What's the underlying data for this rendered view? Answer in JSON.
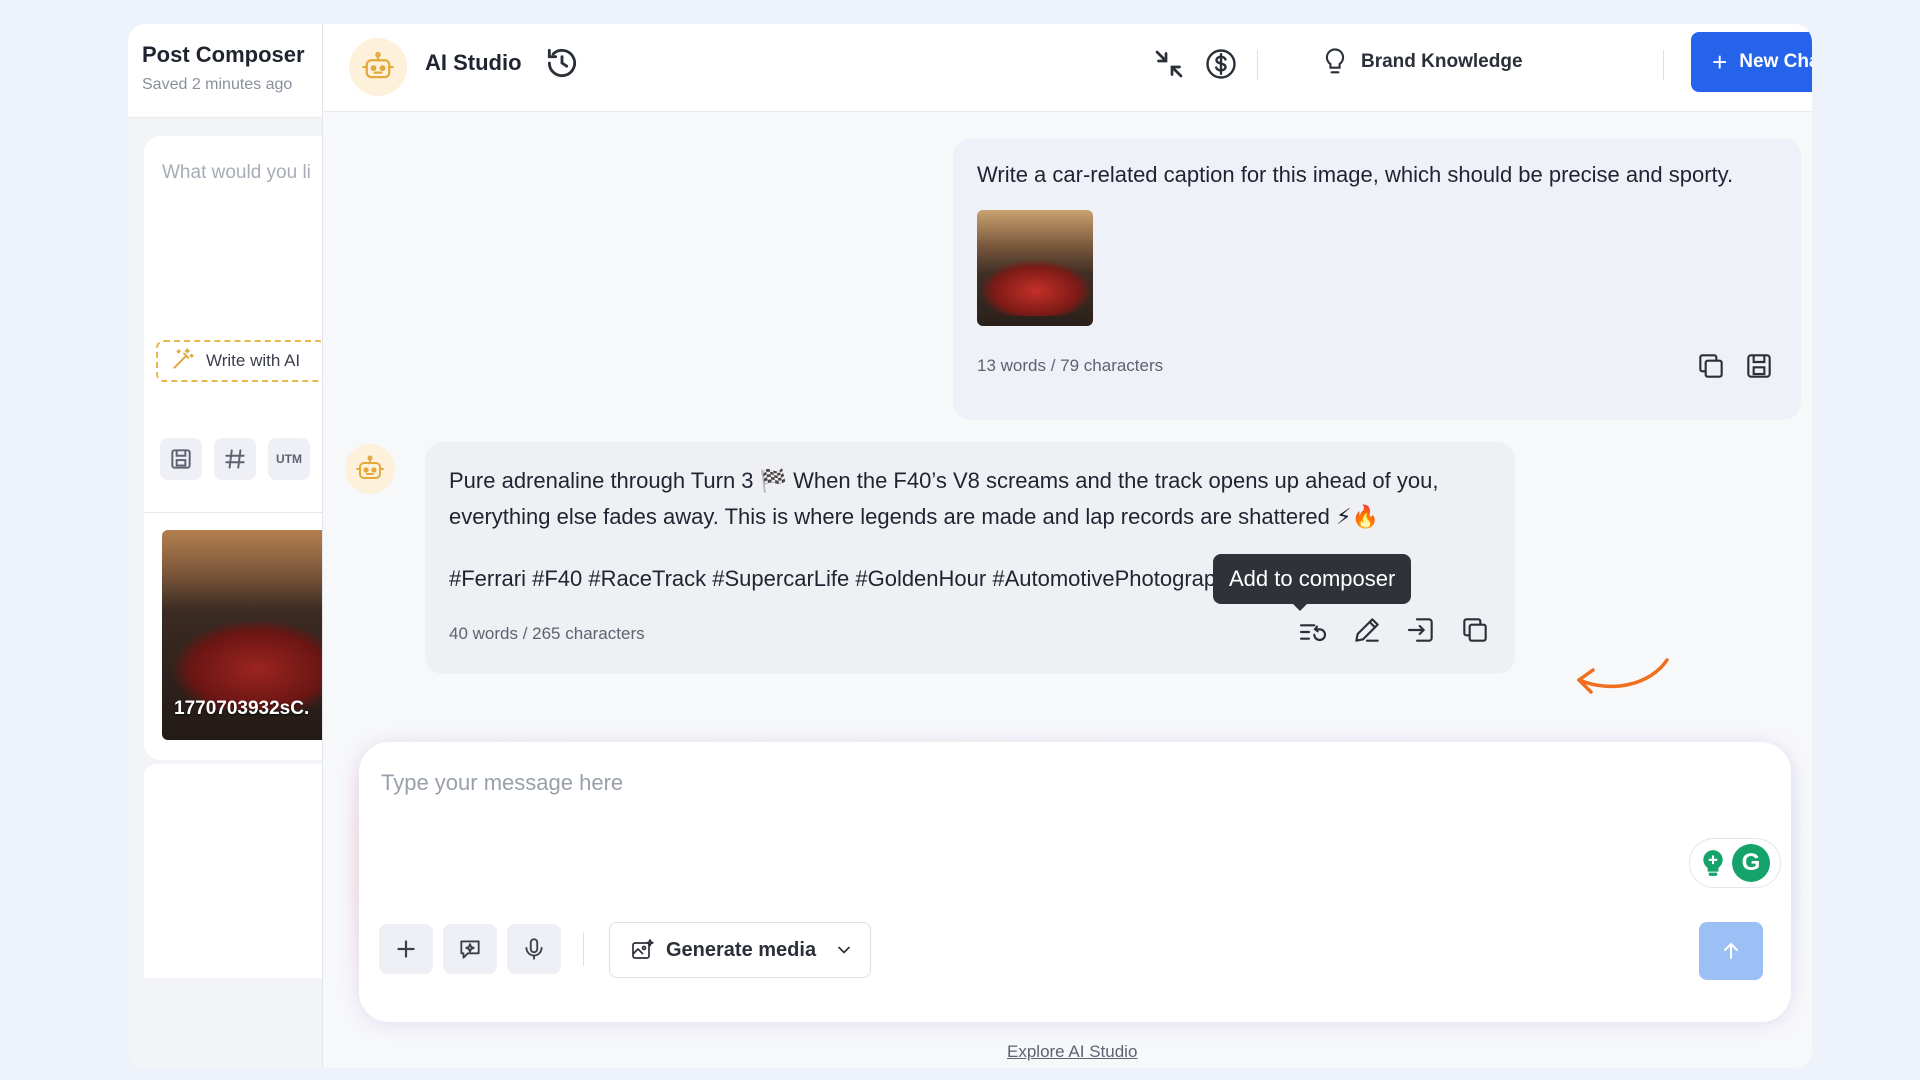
{
  "composer": {
    "title": "Post Composer",
    "saved": "Saved 2 minutes ago",
    "placeholder": "What would you li",
    "write_ai": "Write with AI",
    "tools": [
      "save-icon",
      "hashtag-icon",
      "UTM"
    ],
    "media_name": "1770703932sC."
  },
  "studio": {
    "title": "AI Studio",
    "brand_knowledge": "Brand Knowledge",
    "new_chat": "New Chat",
    "icons": [
      "history-icon",
      "collapse-icon",
      "dollar-icon",
      "bulb-icon",
      "close-icon"
    ]
  },
  "messages": {
    "user": {
      "text": "Write a car-related caption for this image, which should be precise and sporty.",
      "count": "13 words / 79 characters"
    },
    "ai": {
      "line1": "Pure adrenaline through Turn 3 🏁 When the F40’s V8 screams and the track opens up ahead of you,",
      "line2": "everything else fades away. This is where legends are made and lap records are shattered ⚡🔥",
      "hashtags": "#Ferrari #F40 #RaceTrack #SupercarLife #GoldenHour #AutomotivePhotograpl",
      "count": "40 words / 265 characters",
      "tooltip": "Add to composer"
    }
  },
  "input": {
    "placeholder": "Type your message here",
    "generate_media": "Generate media"
  },
  "footer": {
    "explore": "Explore AI Studio"
  },
  "colors": {
    "accent": "#2563eb",
    "send_disabled": "#9cc0f5",
    "annotation_arrow": "#f07020"
  }
}
